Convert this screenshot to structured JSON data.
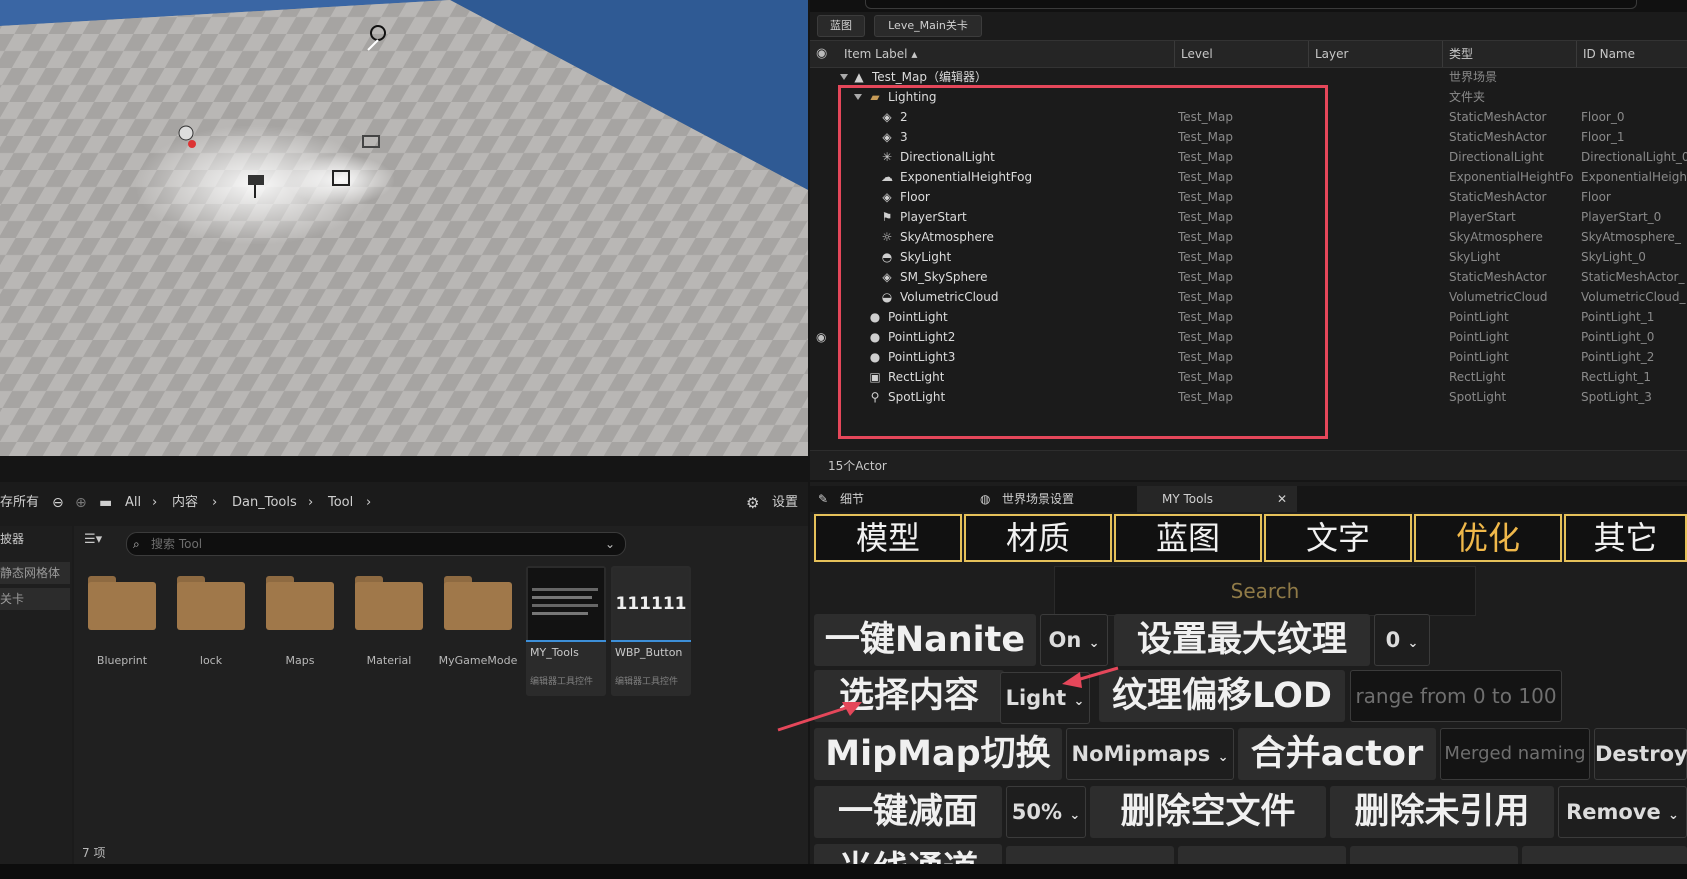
{
  "outliner": {
    "tabs": [
      "蓝图",
      "Leve_Main关卡"
    ],
    "columns": {
      "label": "Item Label ▴",
      "level": "Level",
      "layer": "Layer",
      "type": "类型",
      "id": "ID Name"
    },
    "rows": [
      {
        "name": "Test_Map（编辑器）",
        "level": "",
        "type": "世界场景",
        "id": "",
        "icon": "map-icon",
        "indent": 0
      },
      {
        "name": "Lighting",
        "level": "",
        "type": "文件夹",
        "id": "",
        "icon": "folder-icon",
        "indent": 1
      },
      {
        "name": "2",
        "level": "Test_Map",
        "type": "StaticMeshActor",
        "id": "Floor_0",
        "icon": "cube-icon",
        "indent": 2
      },
      {
        "name": "3",
        "level": "Test_Map",
        "type": "StaticMeshActor",
        "id": "Floor_1",
        "icon": "cube-icon",
        "indent": 2
      },
      {
        "name": "DirectionalLight",
        "level": "Test_Map",
        "type": "DirectionalLight",
        "id": "DirectionalLight_0",
        "icon": "sun-icon",
        "indent": 2
      },
      {
        "name": "ExponentialHeightFog",
        "level": "Test_Map",
        "type": "ExponentialHeightFog",
        "id": "ExponentialHeigh",
        "icon": "fog-icon",
        "indent": 2
      },
      {
        "name": "Floor",
        "level": "Test_Map",
        "type": "StaticMeshActor",
        "id": "Floor",
        "icon": "cube-icon",
        "indent": 2
      },
      {
        "name": "PlayerStart",
        "level": "Test_Map",
        "type": "PlayerStart",
        "id": "PlayerStart_0",
        "icon": "flag-icon",
        "indent": 2
      },
      {
        "name": "SkyAtmosphere",
        "level": "Test_Map",
        "type": "SkyAtmosphere",
        "id": "SkyAtmosphere_",
        "icon": "atmosphere-icon",
        "indent": 2
      },
      {
        "name": "SkyLight",
        "level": "Test_Map",
        "type": "SkyLight",
        "id": "SkyLight_0",
        "icon": "skylight-icon",
        "indent": 2
      },
      {
        "name": "SM_SkySphere",
        "level": "Test_Map",
        "type": "StaticMeshActor",
        "id": "StaticMeshActor_",
        "icon": "cube-icon",
        "indent": 2
      },
      {
        "name": "VolumetricCloud",
        "level": "Test_Map",
        "type": "VolumetricCloud",
        "id": "VolumetricCloud_",
        "icon": "cloud-icon",
        "indent": 2
      },
      {
        "name": "PointLight",
        "level": "Test_Map",
        "type": "PointLight",
        "id": "PointLight_1",
        "icon": "bulb-icon",
        "indent": 1
      },
      {
        "name": "PointLight2",
        "level": "Test_Map",
        "type": "PointLight",
        "id": "PointLight_0",
        "icon": "bulb-icon",
        "indent": 1
      },
      {
        "name": "PointLight3",
        "level": "Test_Map",
        "type": "PointLight",
        "id": "PointLight_2",
        "icon": "bulb-icon",
        "indent": 1
      },
      {
        "name": "RectLight",
        "level": "Test_Map",
        "type": "RectLight",
        "id": "RectLight_1",
        "icon": "rectlight-icon",
        "indent": 1
      },
      {
        "name": "SpotLight",
        "level": "Test_Map",
        "type": "SpotLight",
        "id": "SpotLight_3",
        "icon": "spotlight-icon",
        "indent": 1
      }
    ],
    "status": "15个Actor"
  },
  "content_browser": {
    "add_all": "存所有",
    "breadcrumbs": [
      "All",
      "内容",
      "Dan_Tools",
      "Tool"
    ],
    "settings": "设置",
    "left_items": [
      "披器",
      "静态网格体",
      "关卡"
    ],
    "search_placeholder": "搜索 Tool",
    "folders": [
      "Blueprint",
      "lock",
      "Maps",
      "Material",
      "MyGameMode"
    ],
    "assets": [
      {
        "name": "MY_Tools",
        "sub": "编辑器工具控件"
      },
      {
        "name": "WBP_Button",
        "sub": "编辑器工具控件",
        "thumb_text": "111111"
      }
    ],
    "count": "7 项"
  },
  "tools": {
    "tabs": [
      "细节",
      "世界场景设置",
      "MY Tools"
    ],
    "categories": [
      "模型",
      "材质",
      "蓝图",
      "文字",
      "优化",
      "其它"
    ],
    "search": "Search",
    "rows": {
      "r1": {
        "b1": "一键Nanite",
        "d1": "On",
        "b2": "设置最大纹理",
        "d2": "0"
      },
      "r2": {
        "b1": "选择内容",
        "d1": "Light",
        "b2": "纹理偏移LOD",
        "i1": "range from 0 to 100"
      },
      "r3": {
        "b1": "MipMap切换",
        "d1": "NoMipmaps",
        "b2": "合并actor",
        "i1": "Merged naming",
        "d2": "Destroy"
      },
      "r4": {
        "b1": "一键减面",
        "d1": "50%",
        "b2": "删除空文件",
        "b3": "删除未引用",
        "d2": "Remove"
      },
      "r5": {
        "b1": "光线通道"
      }
    }
  }
}
